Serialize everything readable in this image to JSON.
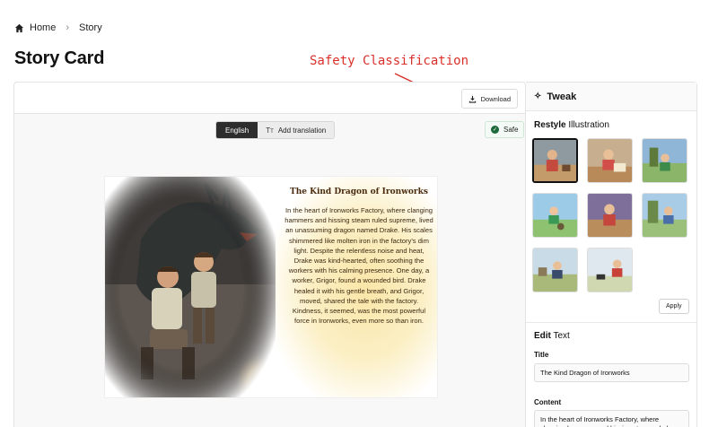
{
  "breadcrumb": {
    "home": "Home",
    "current": "Story"
  },
  "page": {
    "title": "Story Card"
  },
  "annotation": {
    "label": "Safety Classification",
    "color": "#d9302b"
  },
  "toolbar": {
    "download_label": "Download"
  },
  "language": {
    "active": "English",
    "add_translation": "Add translation"
  },
  "safety": {
    "label": "Safe",
    "status_color": "#1e6a3b"
  },
  "story": {
    "title": "The Kind Dragon of Ironworks",
    "body": "In the heart of Ironworks Factory, where clanging hammers and hissing steam ruled supreme, lived an unassuming dragon named Drake. His scales shimmered like molten iron in the factory's dim light. Despite the relentless noise and heat, Drake was kind-hearted, often soothing the workers with his calming presence. One day, a worker, Grigor, found a wounded bird. Drake healed it with his gentle breath, and Grigor, moved, shared the tale with the factory. Kindness, it seemed, was the most powerful force in Ironworks, even more so than iron."
  },
  "tweak": {
    "header": "Tweak",
    "restyle_bold": "Restyle",
    "restyle_rest": " Illustration",
    "apply_label": "Apply",
    "thumbnails_count_shown": 8,
    "selected_index": 0
  },
  "edit": {
    "section_bold": "Edit",
    "section_rest": " Text",
    "title_label": "Title",
    "title_value": "The Kind Dragon of Ironworks",
    "content_label": "Content",
    "content_value": "In the heart of Ironworks Factory, where clanging hammers and hissing steam ruled"
  }
}
